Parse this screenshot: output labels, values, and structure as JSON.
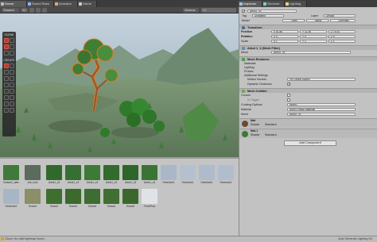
{
  "tabs": [
    {
      "label": "Scene",
      "icon": "scene-icon",
      "active": true
    },
    {
      "label": "Sound Stars",
      "icon": "audio-icon",
      "active": false
    },
    {
      "label": "Animator",
      "icon": "animator-icon",
      "active": false
    },
    {
      "label": "Game",
      "icon": "game-icon",
      "active": false
    }
  ],
  "inspector_tabs": [
    {
      "label": "Inspector",
      "active": true
    },
    {
      "label": "Services",
      "active": false
    },
    {
      "label": "Lighting",
      "active": false
    }
  ],
  "scene_toolbar": {
    "shading_mode": "Shaded",
    "mode_2d": "2D",
    "gizmos": "Gizmos",
    "search_placeholder": "All"
  },
  "tool_overlay": {
    "scene_label": "SCENE",
    "create_label": "CREATE"
  },
  "inspector": {
    "object_name": "Arbol1_x3",
    "tag_label": "Tag",
    "tag_value": "Untagged",
    "layer_label": "Layer",
    "layer_value": "Default",
    "model_label": "Model",
    "model_buttons": [
      "Open",
      "Select",
      "Overrides"
    ],
    "transform": {
      "title": "Transform",
      "rows": [
        {
          "label": "Position",
          "x": "X  81.86",
          "y": "Y  11.38",
          "z": "Z  79.33"
        },
        {
          "label": "Rotation",
          "x": "X  0",
          "y": "Y  0",
          "z": "Z  0"
        },
        {
          "label": "Scale",
          "x": "X  1",
          "y": "Y  1",
          "z": "Z  1"
        }
      ]
    },
    "mesh_filter": {
      "title": "Arbol 1_1 (Mesh Filter)",
      "mesh_label": "Mesh",
      "mesh_value": "Arbol1_x3"
    },
    "mesh_renderer": {
      "title": "Mesh Renderer",
      "sections": [
        "Materials",
        "Lighting",
        "Probes",
        "Additional Settings"
      ],
      "motion_label": "Motion Vectors",
      "motion_value": "Per Object Motion",
      "occlusion_label": "Dynamic Occlusion"
    },
    "mesh_collider": {
      "title": "Mesh Collider",
      "convex_label": "Convex",
      "trigger_label": "Is Trigger",
      "cooking_label": "Cooking Options",
      "cooking_value": "Mixed...",
      "material_label": "Material",
      "material_value": "None (Physic Material)",
      "mesh_label": "Mesh",
      "mesh_value": "Arbol1_x3"
    },
    "materials": [
      {
        "name": "Mat",
        "shader_label": "Shader",
        "shader_value": "Standard"
      },
      {
        "name": "Mat.1",
        "shader_label": "Shader",
        "shader_value": "Standard"
      }
    ],
    "add_component": "Add Component"
  },
  "project_assets": [
    {
      "label": "Grass01_albe",
      "color": "#3f7a3a"
    },
    {
      "label": "Arb_rock",
      "color": "#5b6b5c"
    },
    {
      "label": "Arbol1_x3",
      "color": "#2f6a2c"
    },
    {
      "label": "Arbol1_x3",
      "color": "#356f31"
    },
    {
      "label": "Arbol1_x3",
      "color": "#3c7a35"
    },
    {
      "label": "Arbol1_x3",
      "color": "#316b2e"
    },
    {
      "label": "Arbol1_x3",
      "color": "#2c6629"
    },
    {
      "label": "Arbol1_x3",
      "color": "#3a7434"
    },
    {
      "label": "Hexblock1",
      "color": "#a9b7c9"
    },
    {
      "label": "Hexblock1",
      "color": "#b4c0cf"
    },
    {
      "label": "Hexblock1",
      "color": "#aebbcc"
    },
    {
      "label": "Hexblock1",
      "color": "#b1bdcd"
    },
    {
      "label": "Hexblock1",
      "color": "#a8b5c7"
    },
    {
      "label": "Texture",
      "color": "#8a8f6a"
    },
    {
      "label": "Grass1",
      "color": "#3f6f2f"
    },
    {
      "label": "Grass2",
      "color": "#3b6a2c"
    },
    {
      "label": "Grass3",
      "color": "#3d6d30"
    },
    {
      "label": "Grass4",
      "color": "#406f32"
    },
    {
      "label": "Grass5",
      "color": "#3a682c"
    },
    {
      "label": "TimelFlow",
      "color": "#dfe3e8"
    }
  ],
  "status": {
    "left": "Cloud: No valid lightmap found...",
    "right": "Auto Generate Lighting On"
  },
  "colors": {
    "selection_outline": "#e8751a",
    "terrain": "#6f8a69",
    "sky": "#a9bcc8"
  }
}
